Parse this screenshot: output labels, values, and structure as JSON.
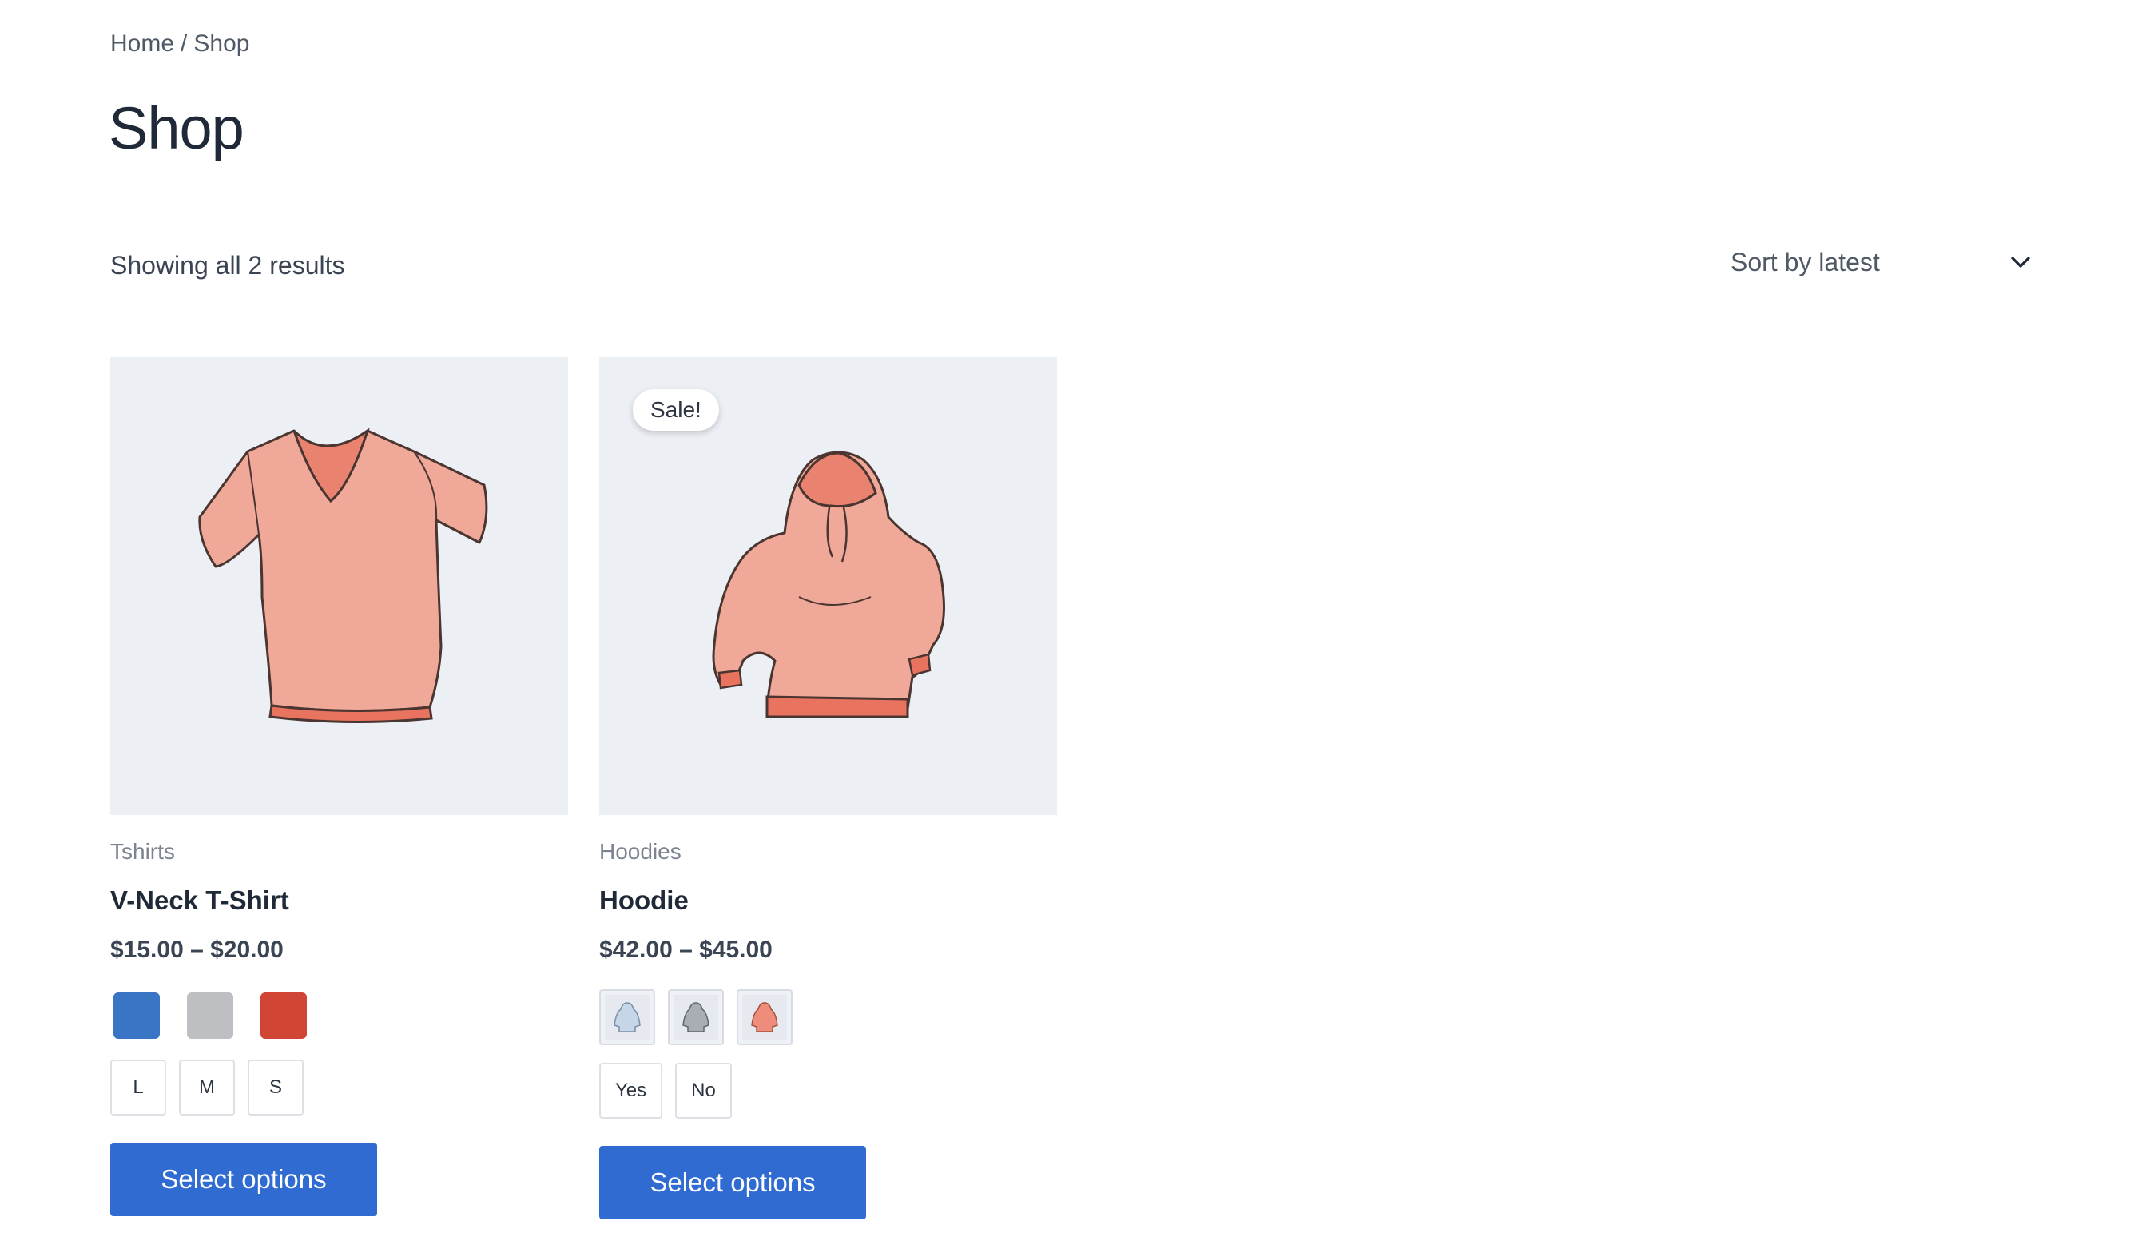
{
  "breadcrumb": {
    "home": "Home",
    "separator": "/",
    "current": "Shop"
  },
  "page": {
    "title": "Shop"
  },
  "results": {
    "count_text": "Showing all 2 results"
  },
  "sort": {
    "selected": "Sort by latest",
    "icon": "chevron-down-icon"
  },
  "products": [
    {
      "category": "Tshirts",
      "name": "V-Neck T-Shirt",
      "price": "$15.00 – $20.00",
      "sale_badge": "",
      "color_swatches": [
        {
          "name": "Blue",
          "color": "#3a74c4"
        },
        {
          "name": "Gray",
          "color": "#bdbfc3"
        },
        {
          "name": "Red",
          "color": "#d04536"
        }
      ],
      "label_options": [
        "L",
        "M",
        "S"
      ],
      "button": "Select options"
    },
    {
      "category": "Hoodies",
      "name": "Hoodie",
      "price": "$42.00 – $45.00",
      "sale_badge": "Sale!",
      "image_swatches": [
        {
          "name": "Blue",
          "color": "#c5d6e8"
        },
        {
          "name": "Gray",
          "color": "#a8aeb4"
        },
        {
          "name": "Red",
          "color": "#ee8d7c"
        }
      ],
      "label_options": [
        "Yes",
        "No"
      ],
      "button": "Select options"
    }
  ],
  "colors": {
    "accent": "#2f6bd0",
    "image_bg": "#eceff4",
    "garment": "#f0a898",
    "garment_dark": "#e8735e"
  }
}
